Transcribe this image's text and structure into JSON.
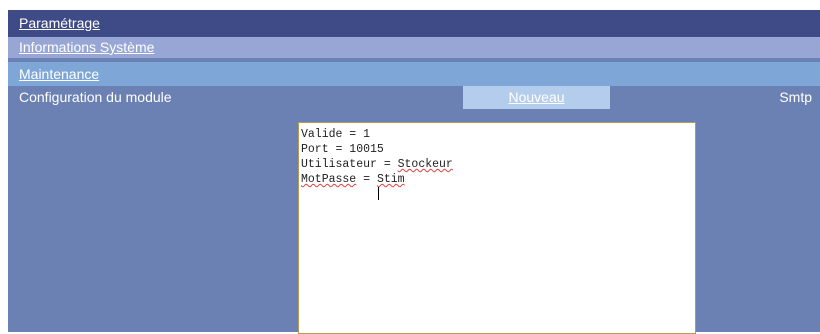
{
  "nav": {
    "parametrage": "Paramétrage",
    "informations_systeme": "Informations Système",
    "maintenance": "Maintenance"
  },
  "module": {
    "title": "Configuration du module",
    "new_button": "Nouveau",
    "right_label": "Smtp"
  },
  "editor": {
    "lines": {
      "valide": "Valide = 1",
      "port": "Port = 10015",
      "user_key": "Utilisateur = ",
      "user_val": "Stockeur",
      "pass_key": "MotPasse",
      "pass_eq": " = ",
      "pass_val": "Stim"
    }
  },
  "colors": {
    "dark_bar": "#3f4b86",
    "light_bar": "#97a6d5",
    "maintenance_bar": "#7ea6d7",
    "panel": "#6b80b3",
    "button": "#b4cdec",
    "editor_border": "#b79a55"
  }
}
